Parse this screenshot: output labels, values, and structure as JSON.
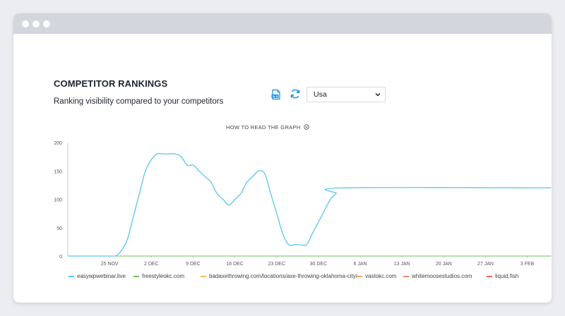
{
  "window": {
    "dots": [
      "dot",
      "dot",
      "dot"
    ]
  },
  "header": {
    "title": "COMPETITOR RANKINGS",
    "subtitle": "Ranking visibility compared to your competitors"
  },
  "toolbar": {
    "export_icon": "xls-export-icon",
    "refresh_icon": "refresh-icon",
    "country_selected": "Usa"
  },
  "howto": {
    "label": "HOW TO READ THE GRAPH"
  },
  "colors": {
    "accent": "#1a8fe0",
    "series": [
      "#5bc4f0",
      "#6cbf5c",
      "#f2c14e",
      "#f0a35b",
      "#ee8e66",
      "#ea6a4e"
    ]
  },
  "chart_data": {
    "type": "line",
    "x_ticks": [
      "25 NOV",
      "2 DEC",
      "9 DEC",
      "16 DEC",
      "23 DEC",
      "30 DEC",
      "6 JAN",
      "13 JAN",
      "20 JAN",
      "27 JAN",
      "3 FEB"
    ],
    "y_ticks": [
      "0",
      "50",
      "100",
      "150",
      "200"
    ],
    "ylim": [
      0,
      200
    ],
    "grid": false,
    "legend_position": "bottom",
    "x": [
      "2023-11-18",
      "2023-11-19",
      "2023-11-20",
      "2023-11-21",
      "2023-11-22",
      "2023-11-23",
      "2023-11-24",
      "2023-11-25",
      "2023-11-26",
      "2023-11-27",
      "2023-11-28",
      "2023-11-29",
      "2023-11-30",
      "2023-12-01",
      "2023-12-02",
      "2023-12-03",
      "2023-12-04",
      "2023-12-05",
      "2023-12-06",
      "2023-12-07",
      "2023-12-08",
      "2023-12-09",
      "2023-12-10",
      "2023-12-11",
      "2023-12-12",
      "2023-12-13",
      "2023-12-14",
      "2023-12-15",
      "2023-12-16",
      "2023-12-17",
      "2023-12-18",
      "2023-12-19",
      "2023-12-20",
      "2023-12-21",
      "2023-12-22",
      "2023-12-23",
      "2023-12-24",
      "2023-12-25",
      "2023-12-26",
      "2023-12-27",
      "2023-12-28",
      "2023-12-29",
      "2023-12-30",
      "2023-12-31",
      "2024-01-01",
      "2024-01-02",
      "2024-01-03",
      "2024-02-07"
    ],
    "series": [
      {
        "name": "easywpwebinar.live",
        "values": [
          0,
          0,
          0,
          0,
          0,
          0,
          0,
          0,
          0,
          10,
          30,
          70,
          110,
          150,
          170,
          180,
          180,
          180,
          180,
          175,
          160,
          160,
          150,
          140,
          130,
          110,
          100,
          90,
          100,
          110,
          130,
          140,
          150,
          145,
          110,
          75,
          40,
          20,
          20,
          20,
          20,
          40,
          60,
          80,
          100,
          110,
          120,
          120
        ]
      },
      {
        "name": "freestyleokc.com",
        "values": [
          0,
          0,
          0,
          0,
          0,
          0,
          0,
          0,
          0,
          0,
          0,
          0,
          0,
          0,
          0,
          0,
          0,
          0,
          0,
          0,
          0,
          0,
          0,
          0,
          0,
          0,
          0,
          0,
          0,
          0,
          0,
          0,
          0,
          0,
          0,
          0,
          0,
          0,
          0,
          0,
          0,
          0,
          0,
          0,
          0,
          0,
          0,
          0
        ]
      },
      {
        "name": "badaxethrowing.com/locations/axe-throwing-oklahoma-city/",
        "values": [
          0,
          0,
          0,
          0,
          0,
          0,
          0,
          0,
          0,
          0,
          0,
          0,
          0,
          0,
          0,
          0,
          0,
          0,
          0,
          0,
          0,
          0,
          0,
          0,
          0,
          0,
          0,
          0,
          0,
          0,
          0,
          0,
          0,
          0,
          0,
          0,
          0,
          0,
          0,
          0,
          0,
          0,
          0,
          0,
          0,
          0,
          0,
          0
        ]
      },
      {
        "name": "vastokc.com",
        "values": [
          0,
          0,
          0,
          0,
          0,
          0,
          0,
          0,
          0,
          0,
          0,
          0,
          0,
          0,
          0,
          0,
          0,
          0,
          0,
          0,
          0,
          0,
          0,
          0,
          0,
          0,
          0,
          0,
          0,
          0,
          0,
          0,
          0,
          0,
          0,
          0,
          0,
          0,
          0,
          0,
          0,
          0,
          0,
          0,
          0,
          0,
          0,
          0
        ]
      },
      {
        "name": "whitemoosestudios.com",
        "values": [
          0,
          0,
          0,
          0,
          0,
          0,
          0,
          0,
          0,
          0,
          0,
          0,
          0,
          0,
          0,
          0,
          0,
          0,
          0,
          0,
          0,
          0,
          0,
          0,
          0,
          0,
          0,
          0,
          0,
          0,
          0,
          0,
          0,
          0,
          0,
          0,
          0,
          0,
          0,
          0,
          0,
          0,
          0,
          0,
          0,
          0,
          0,
          0
        ]
      },
      {
        "name": "liquid.fish",
        "values": [
          0,
          0,
          0,
          0,
          0,
          0,
          0,
          0,
          0,
          0,
          0,
          0,
          0,
          0,
          0,
          0,
          0,
          0,
          0,
          0,
          0,
          0,
          0,
          0,
          0,
          0,
          0,
          0,
          0,
          0,
          0,
          0,
          0,
          0,
          0,
          0,
          0,
          0,
          0,
          0,
          0,
          0,
          0,
          0,
          0,
          0,
          0,
          0
        ]
      }
    ]
  }
}
